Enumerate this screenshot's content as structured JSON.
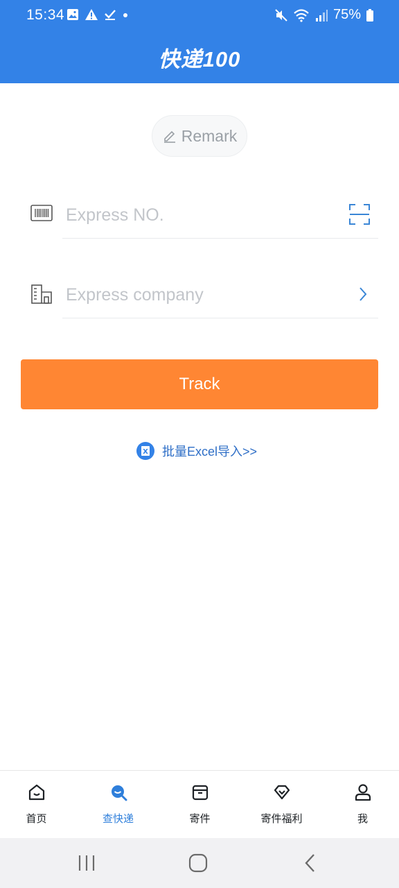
{
  "status_bar": {
    "time": "15:34",
    "battery": "75%",
    "left_icons": [
      "image-icon",
      "warning-icon",
      "check-icon",
      "dot-icon"
    ],
    "right_icons": [
      "mute-icon",
      "wifi-icon",
      "signal-icon",
      "battery-icon"
    ]
  },
  "header": {
    "title": "快递100",
    "background": "#3382e7"
  },
  "remark": {
    "label": "Remark"
  },
  "express_no": {
    "placeholder": "Express NO."
  },
  "express_company": {
    "placeholder": "Express company"
  },
  "track": {
    "label": "Track",
    "color": "#ff8633"
  },
  "excel_import": {
    "label": "批量Excel导入>>"
  },
  "bottom_nav": {
    "items": [
      {
        "label": "首页",
        "icon": "home-icon"
      },
      {
        "label": "查快递",
        "icon": "search-parcel-icon",
        "active": true
      },
      {
        "label": "寄件",
        "icon": "box-icon"
      },
      {
        "label": "寄件福利",
        "icon": "gift-heart-icon"
      },
      {
        "label": "我",
        "icon": "user-icon"
      }
    ],
    "active_color": "#2f7fdb"
  },
  "android_nav": {
    "buttons": [
      "recents-button",
      "home-button",
      "back-button"
    ]
  }
}
